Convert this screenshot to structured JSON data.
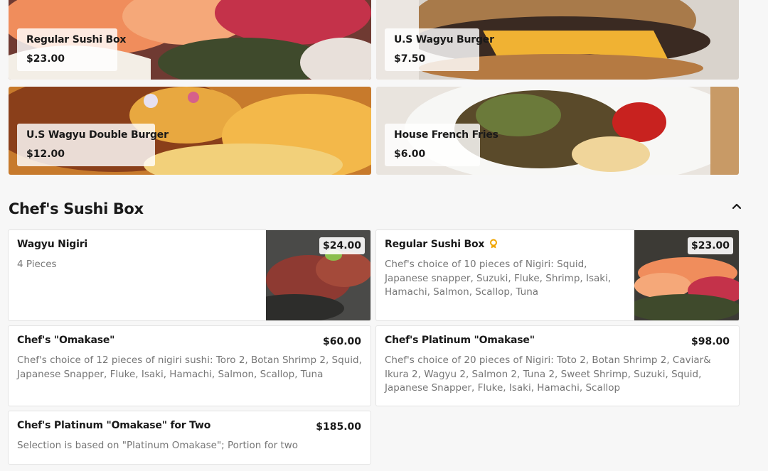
{
  "top_tiles": [
    {
      "name": "Regular Sushi Box",
      "price": "$23.00"
    },
    {
      "name": "U.S Wagyu Burger",
      "price": "$7.50"
    },
    {
      "name": "U.S Wagyu Double Burger",
      "price": "$12.00"
    },
    {
      "name": "House French Fries",
      "price": "$6.00"
    }
  ],
  "section": {
    "title": "Chef's Sushi Box",
    "collapse_icon": "chevron-up-icon"
  },
  "items": [
    {
      "name": "Wagyu Nigiri",
      "desc": "4 Pieces",
      "price": "$24.00"
    },
    {
      "name": "Regular Sushi Box",
      "desc": "Chef's choice of 10 pieces of Nigiri: Squid, Japanese snapper, Suzuki, Fluke, Shrimp, Isaki, Hamachi, Salmon, Scallop, Tuna",
      "price": "$23.00",
      "badge_icon": "award-icon"
    },
    {
      "name": "Chef's \"Omakase\"",
      "desc": "Chef's choice of 12 pieces of nigiri sushi: Toro 2, Botan Shrimp 2, Squid, Japanese Snapper, Fluke, Isaki, Hamachi, Salmon, Scallop, Tuna",
      "price": "$60.00"
    },
    {
      "name": "Chef's Platinum \"Omakase\"",
      "desc": "Chef's choice of 20 pieces of Nigiri: Toto 2, Botan Shrimp 2, Caviar& Ikura 2, Wagyu 2, Salmon 2, Tuna 2, Sweet Shrimp, Suzuki, Squid, Japanese Snapper, Fluke, Isaki, Hamachi, Scallop",
      "price": "$98.00"
    },
    {
      "name": "Chef's Platinum \"Omakase\" for Two",
      "desc": "Selection is based on \"Platinum Omakase\"; Portion for two",
      "price": "$185.00"
    }
  ],
  "colors": {
    "accent": "#f0a500",
    "text": "#191919",
    "muted": "#767676"
  }
}
